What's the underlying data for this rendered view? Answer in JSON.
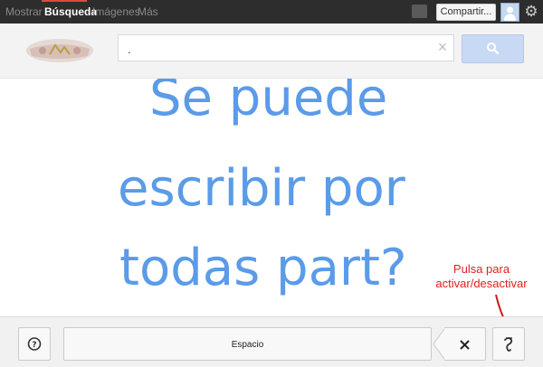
{
  "nav": {
    "items": [
      "Mostrar",
      "Búsqueda",
      "Imágenes",
      "Más"
    ],
    "share_label": "Compartir..."
  },
  "search": {
    "value": ".",
    "clear_glyph": "×"
  },
  "handwriting": {
    "lines": [
      "Se puede",
      "escribir por",
      "todas part?"
    ],
    "ink_color": "#5b9be8"
  },
  "annotation": {
    "line1": "Pulsa para",
    "line2": "activar/desactivar",
    "color": "#e02020"
  },
  "toolbar": {
    "space_label": "Espacio",
    "backspace_glyph": "×"
  },
  "colors": {
    "topbar": "#2d2d2d",
    "active_tab_accent": "#dd4b39",
    "search_button": "#c8d9f5"
  }
}
